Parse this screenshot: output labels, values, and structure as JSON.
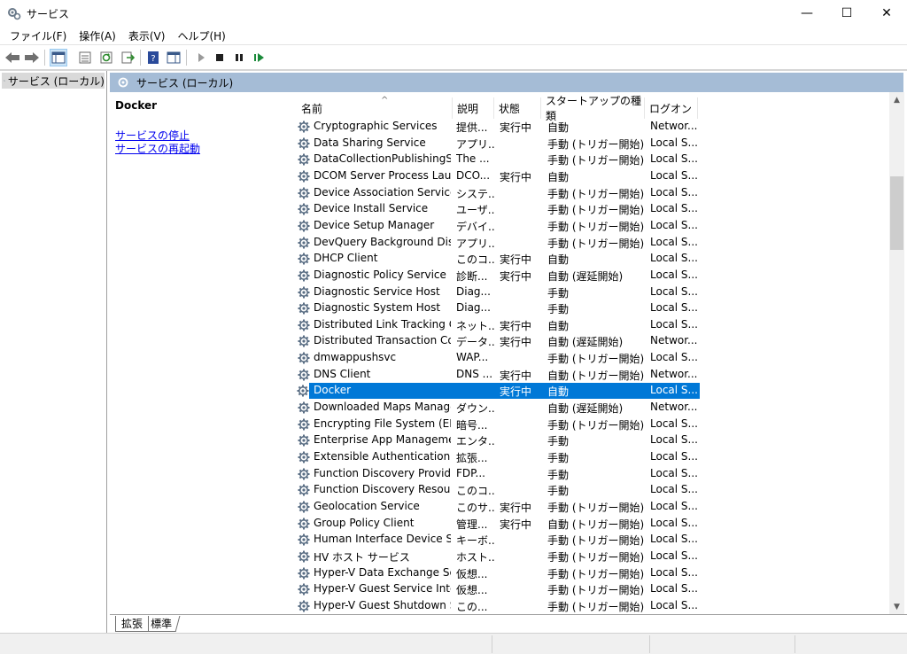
{
  "window": {
    "title": "サービス",
    "min_glyph": "—",
    "max_glyph": "☐",
    "close_glyph": "✕"
  },
  "menu": [
    "ファイル(F)",
    "操作(A)",
    "表示(V)",
    "ヘルプ(H)"
  ],
  "tree": {
    "root_label": "サービス (ローカル)"
  },
  "pane": {
    "header_title": "サービス (ローカル)",
    "selected_service": "Docker",
    "link_stop": "サービスの停止",
    "link_restart": "サービスの再起動"
  },
  "columns": {
    "name": "名前",
    "description": "説明",
    "status": "状態",
    "startup": "スタートアップの種類",
    "logon": "ログオン",
    "sort_indicator": "^"
  },
  "services": [
    {
      "name": "Cryptographic Services",
      "desc": "提供...",
      "status": "実行中",
      "startup": "自動",
      "logon": "Networ..."
    },
    {
      "name": "Data Sharing Service",
      "desc": "アプリ...",
      "status": "",
      "startup": "手動 (トリガー開始)",
      "logon": "Local S..."
    },
    {
      "name": "DataCollectionPublishingSe...",
      "desc": "The ...",
      "status": "",
      "startup": "手動 (トリガー開始)",
      "logon": "Local S..."
    },
    {
      "name": "DCOM Server Process Laun...",
      "desc": "DCO...",
      "status": "実行中",
      "startup": "自動",
      "logon": "Local S..."
    },
    {
      "name": "Device Association Service",
      "desc": "システ...",
      "status": "",
      "startup": "手動 (トリガー開始)",
      "logon": "Local S..."
    },
    {
      "name": "Device Install Service",
      "desc": "ユーザ...",
      "status": "",
      "startup": "手動 (トリガー開始)",
      "logon": "Local S..."
    },
    {
      "name": "Device Setup Manager",
      "desc": "デバイ...",
      "status": "",
      "startup": "手動 (トリガー開始)",
      "logon": "Local S..."
    },
    {
      "name": "DevQuery Background Disc...",
      "desc": "アプリ...",
      "status": "",
      "startup": "手動 (トリガー開始)",
      "logon": "Local S..."
    },
    {
      "name": "DHCP Client",
      "desc": "このコ...",
      "status": "実行中",
      "startup": "自動",
      "logon": "Local S..."
    },
    {
      "name": "Diagnostic Policy Service",
      "desc": "診断...",
      "status": "実行中",
      "startup": "自動 (遅延開始)",
      "logon": "Local S..."
    },
    {
      "name": "Diagnostic Service Host",
      "desc": "Diag...",
      "status": "",
      "startup": "手動",
      "logon": "Local S..."
    },
    {
      "name": "Diagnostic System Host",
      "desc": "Diag...",
      "status": "",
      "startup": "手動",
      "logon": "Local S..."
    },
    {
      "name": "Distributed Link Tracking Cli...",
      "desc": "ネット...",
      "status": "実行中",
      "startup": "自動",
      "logon": "Local S..."
    },
    {
      "name": "Distributed Transaction Coo...",
      "desc": "データ...",
      "status": "実行中",
      "startup": "自動 (遅延開始)",
      "logon": "Networ..."
    },
    {
      "name": "dmwappushsvc",
      "desc": "WAP...",
      "status": "",
      "startup": "手動 (トリガー開始)",
      "logon": "Local S..."
    },
    {
      "name": "DNS Client",
      "desc": "DNS ...",
      "status": "実行中",
      "startup": "自動 (トリガー開始)",
      "logon": "Networ..."
    },
    {
      "name": "Docker",
      "desc": "",
      "status": "実行中",
      "startup": "自動",
      "logon": "Local S...",
      "selected": true
    },
    {
      "name": "Downloaded Maps Manager",
      "desc": "ダウン...",
      "status": "",
      "startup": "自動 (遅延開始)",
      "logon": "Networ..."
    },
    {
      "name": "Encrypting File System (EFS)",
      "desc": "暗号...",
      "status": "",
      "startup": "手動 (トリガー開始)",
      "logon": "Local S..."
    },
    {
      "name": "Enterprise App Managemen...",
      "desc": "エンタ...",
      "status": "",
      "startup": "手動",
      "logon": "Local S..."
    },
    {
      "name": "Extensible Authentication P...",
      "desc": "拡張...",
      "status": "",
      "startup": "手動",
      "logon": "Local S..."
    },
    {
      "name": "Function Discovery Provider...",
      "desc": "FDP...",
      "status": "",
      "startup": "手動",
      "logon": "Local S..."
    },
    {
      "name": "Function Discovery Resourc...",
      "desc": "このコ...",
      "status": "",
      "startup": "手動",
      "logon": "Local S..."
    },
    {
      "name": "Geolocation Service",
      "desc": "このサ...",
      "status": "実行中",
      "startup": "手動 (トリガー開始)",
      "logon": "Local S..."
    },
    {
      "name": "Group Policy Client",
      "desc": "管理...",
      "status": "実行中",
      "startup": "自動 (トリガー開始)",
      "logon": "Local S..."
    },
    {
      "name": "Human Interface Device Ser...",
      "desc": "キーボ...",
      "status": "",
      "startup": "手動 (トリガー開始)",
      "logon": "Local S..."
    },
    {
      "name": "HV ホスト サービス",
      "desc": "ホスト...",
      "status": "",
      "startup": "手動 (トリガー開始)",
      "logon": "Local S..."
    },
    {
      "name": "Hyper-V Data Exchange Ser...",
      "desc": "仮想...",
      "status": "",
      "startup": "手動 (トリガー開始)",
      "logon": "Local S..."
    },
    {
      "name": "Hyper-V Guest Service Interf...",
      "desc": "仮想...",
      "status": "",
      "startup": "手動 (トリガー開始)",
      "logon": "Local S..."
    },
    {
      "name": "Hyper-V Guest Shutdown S...",
      "desc": "この...",
      "status": "",
      "startup": "手動 (トリガー開始)",
      "logon": "Local S..."
    }
  ],
  "tabs": {
    "extended": "拡張",
    "standard": "標準"
  },
  "colors": {
    "selection": "#0078d7",
    "pane_header": "#a5bcd6",
    "link": "#0000ee"
  }
}
